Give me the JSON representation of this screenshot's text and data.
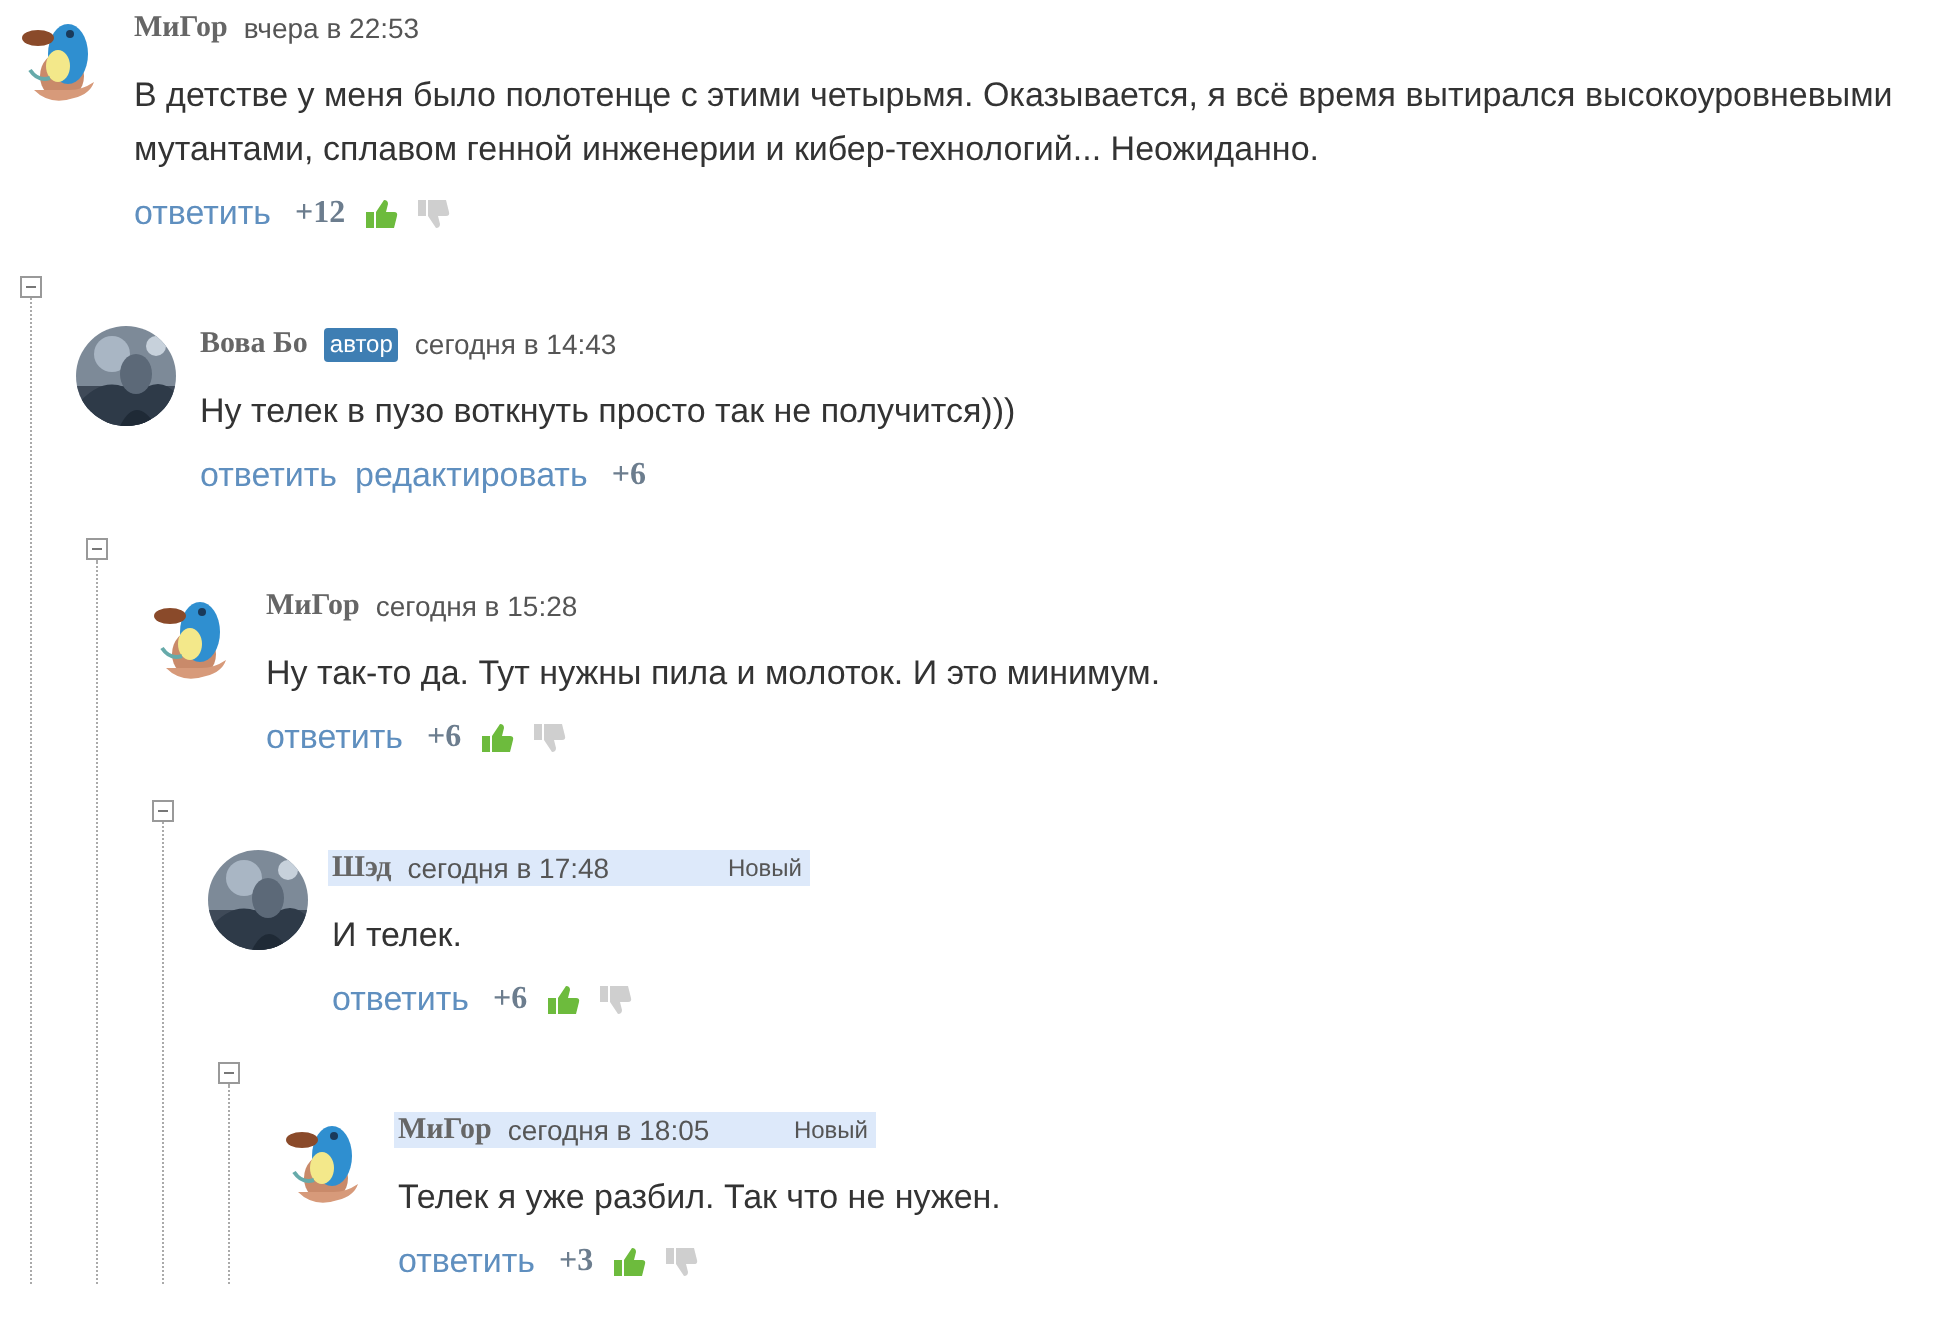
{
  "comments": [
    {
      "author": "МиГор",
      "time": "вчера в 22:53",
      "avatar": {
        "kind": "drawing"
      },
      "text": "В детстве у меня было полотенце с этими четырьмя. Оказывается, я всё время вытирался высокоуровневыми мутантами, сплавом генной инженерии и кибер-технологий... Неожиданно.",
      "actions": [
        "ответить"
      ],
      "score": "+12",
      "voting": true,
      "children": [
        {
          "expanded": true,
          "author": "Вова Бо",
          "badge": "автор",
          "time": "сегодня в 14:43",
          "avatar": {
            "kind": "picture"
          },
          "text": "Ну телек в пузо воткнуть просто так не получится)))",
          "actions": [
            "ответить",
            "редактировать"
          ],
          "score": "+6",
          "voting": false,
          "children": [
            {
              "expanded": true,
              "author": "МиГор",
              "time": "сегодня в 15:28",
              "avatar": {
                "kind": "drawing"
              },
              "text": "Ну так-то да. Тут нужны пила и молоток. И это минимум.",
              "actions": [
                "ответить"
              ],
              "score": "+6",
              "voting": true,
              "children": [
                {
                  "expanded": true,
                  "author": "Шэд",
                  "time": "сегодня в 17:48",
                  "new_label": "Новый",
                  "avatar": {
                    "kind": "picture"
                  },
                  "text": "И телек.",
                  "actions": [
                    "ответить"
                  ],
                  "score": "+6",
                  "voting": true,
                  "children": [
                    {
                      "expanded": true,
                      "author": "МиГор",
                      "time": "сегодня в 18:05",
                      "new_label": "Новый",
                      "avatar": {
                        "kind": "drawing"
                      },
                      "text": "Телек я уже разбил. Так что не нужен.",
                      "actions": [
                        "ответить"
                      ],
                      "score": "+3",
                      "voting": true
                    }
                  ]
                }
              ]
            }
          ]
        }
      ]
    }
  ]
}
